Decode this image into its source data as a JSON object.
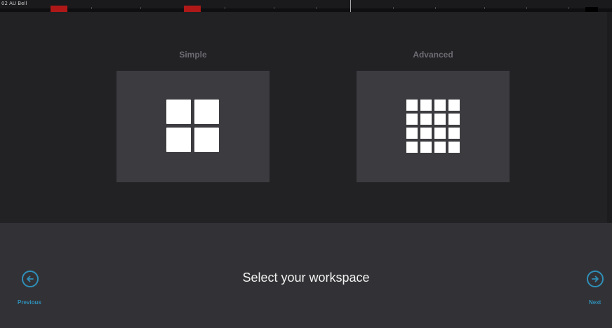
{
  "track": {
    "label": "02 AU Bell"
  },
  "workspaces": {
    "simple": {
      "label": "Simple",
      "icon": "grid-2x2-icon"
    },
    "advanced": {
      "label": "Advanced",
      "icon": "grid-4x4-icon"
    }
  },
  "footer": {
    "title": "Select your workspace",
    "previous_label": "Previous",
    "next_label": "Next",
    "previous_icon": "arrow-left-circle-icon",
    "next_icon": "arrow-right-circle-icon"
  },
  "colors": {
    "background": "#222225",
    "card": "#3c3c40",
    "footer": "#323236",
    "accent": "#2f8fb8",
    "region": "#b01818"
  }
}
